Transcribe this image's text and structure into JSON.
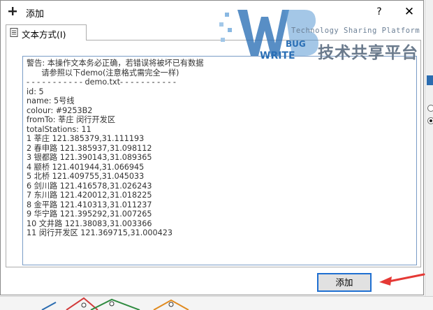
{
  "window": {
    "title": "添加",
    "help_label": "?",
    "close_label": "✕"
  },
  "tabs": [
    {
      "label": "文本方式(I)"
    }
  ],
  "text_content": {
    "lines": [
      "警告: 本操作文本务必正确，若错误将被坏已有数据",
      "      请参照以下demo(注意格式需完全一样)",
      "- - - - - - - - - - - demo.txt- - - - - - - - - - -",
      "id: 5",
      "name: 5号线",
      "colour: #9253B2",
      "fromTo: 莘庄 闵行开发区",
      "totalStations: 11",
      "1 莘庄 121.385379,31.111193",
      "2 春申路 121.385937,31.098112",
      "3 银都路 121.390143,31.089365",
      "4 颛桥 121.401944,31.066945",
      "5 北桥 121.409755,31.045033",
      "6 剑川路 121.416578,31.026243",
      "7 东川路 121.420012,31.018225",
      "8 金平路 121.410313,31.011237",
      "9 华宁路 121.395292,31.007265",
      "10 文井路 121.38083,31.003366",
      "11 闵行开发区 121.369715,31.000423"
    ]
  },
  "buttons": {
    "add_label": "添加"
  },
  "watermark": {
    "slogan": "Technology Sharing Platform",
    "cn_text": "技术共享平台",
    "bug_text": "BUG",
    "write_text": "WRITE"
  },
  "colors": {
    "accent_blue": "#1f6fd1",
    "annotation_red": "#e53935",
    "text_area_border": "#7a9cc6"
  },
  "icons": {
    "title": "plus-icon",
    "tab": "document-icon",
    "annotation": "red-arrow-icon"
  }
}
